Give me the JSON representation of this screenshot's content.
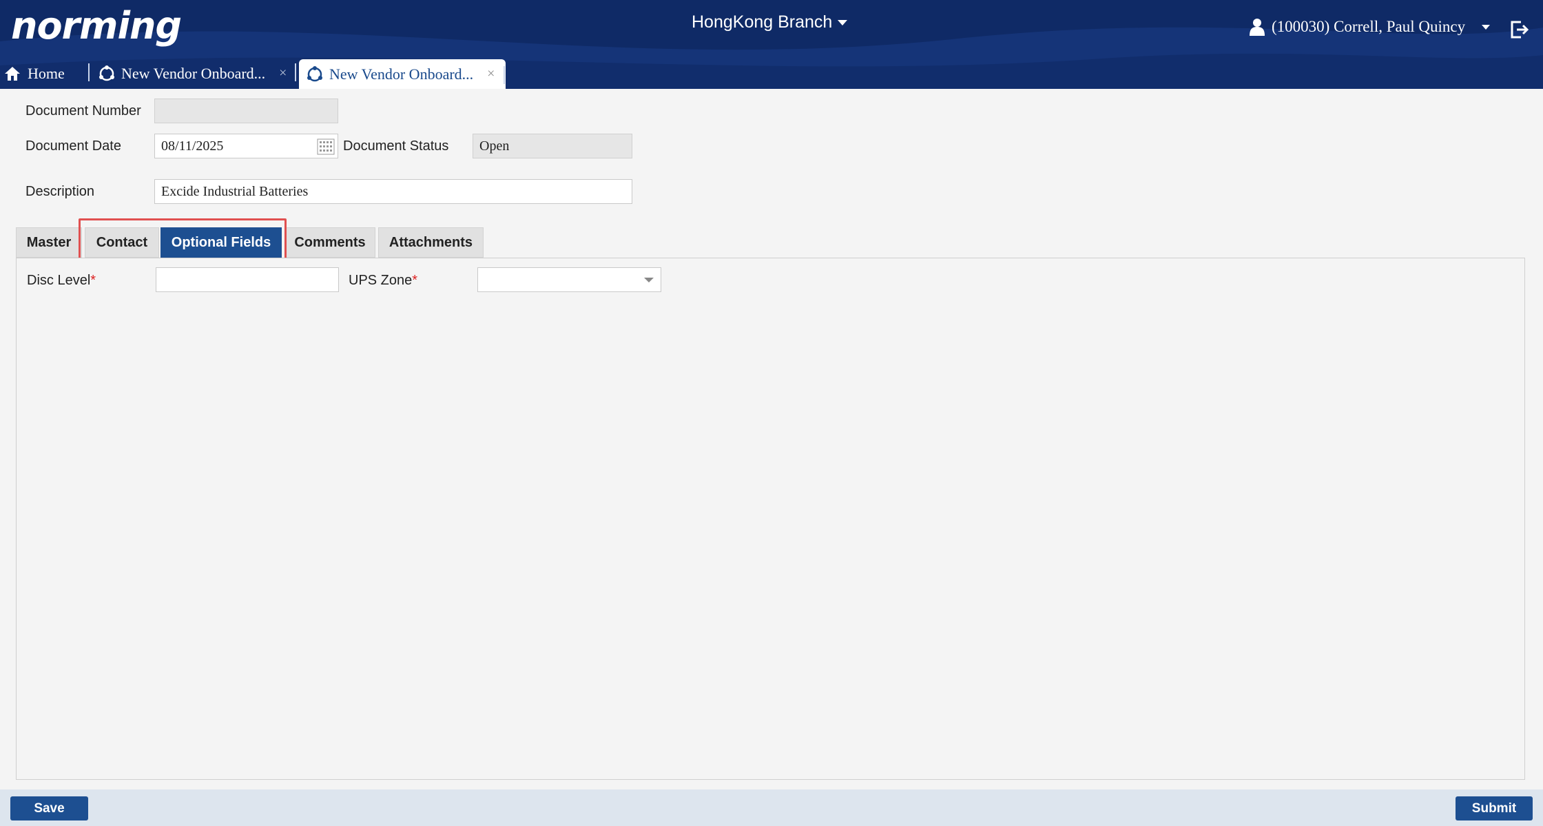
{
  "header": {
    "logo": "norming",
    "branch": "HongKong Branch",
    "user": "(100030) Correll, Paul Quincy"
  },
  "tabs": {
    "home": "Home",
    "doc_tab_1": "New Vendor Onboard...",
    "doc_tab_2": "New Vendor Onboard...",
    "close_glyph": "×"
  },
  "form": {
    "document_number_label": "Document Number",
    "document_number_value": "",
    "document_date_label": "Document Date",
    "document_date_value": "08/11/2025",
    "document_status_label": "Document Status",
    "document_status_value": "Open",
    "description_label": "Description",
    "description_value": "Excide Industrial Batteries"
  },
  "section_tabs": [
    {
      "label": "Master"
    },
    {
      "label": "Contact"
    },
    {
      "label": "Optional Fields",
      "active": true
    },
    {
      "label": "Comments"
    },
    {
      "label": "Attachments"
    }
  ],
  "optional_fields": {
    "disc_level_label": "Disc Level",
    "disc_level_value": "",
    "ups_zone_label": "UPS Zone",
    "ups_zone_value": "",
    "required_mark": "*"
  },
  "footer": {
    "save_label": "Save",
    "submit_label": "Submit"
  },
  "colors": {
    "header_bg": "#0f2a66",
    "accent": "#1d4f91",
    "highlight": "#e05050",
    "required": "#dd2222"
  }
}
